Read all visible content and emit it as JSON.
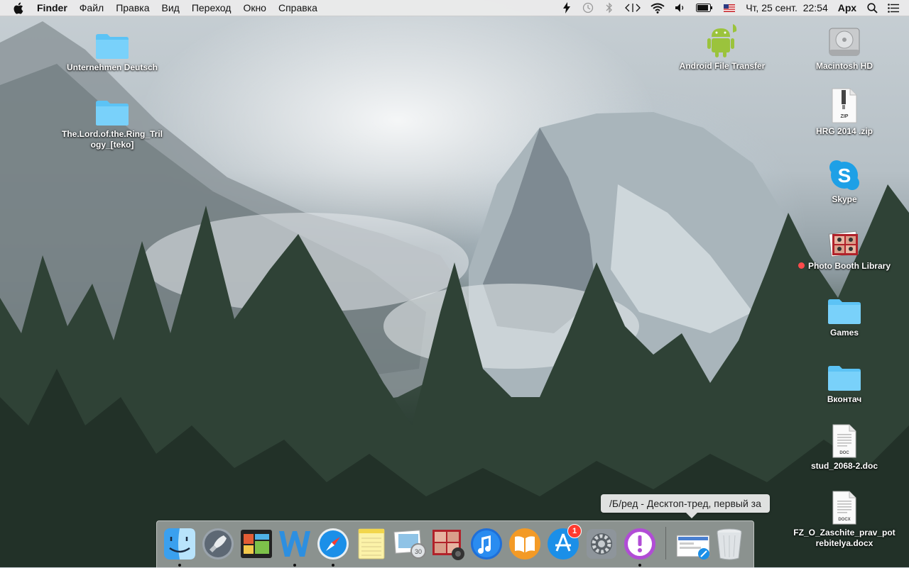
{
  "menubar": {
    "app_name": "Finder",
    "menus": [
      "Файл",
      "Правка",
      "Вид",
      "Переход",
      "Окно",
      "Справка"
    ],
    "clock": "Чт, 25 сент.  22:54",
    "user": "Арх"
  },
  "desktop_icons": [
    {
      "label": "Unternehmen Deutsch",
      "icon": "folder-icon"
    },
    {
      "label": "The.Lord.of.the.Ring_Trilogy_[teko]",
      "icon": "folder-icon"
    },
    {
      "label": "Android File Transfer",
      "icon": "android-icon"
    },
    {
      "label": "Macintosh HD",
      "icon": "hard-drive-icon"
    },
    {
      "label": "HRG 2014 .zip",
      "icon": "zip-file-icon",
      "badge": "ZIP"
    },
    {
      "label": "Skype",
      "icon": "skype-icon"
    },
    {
      "label": "Photo Booth Library",
      "icon": "photo-booth-library-icon",
      "tag_color": "#ff4b4b"
    },
    {
      "label": "Games",
      "icon": "folder-icon"
    },
    {
      "label": "Вконтач",
      "icon": "folder-icon"
    },
    {
      "label": "stud_2068-2.doc",
      "icon": "doc-file-icon",
      "badge": "DOC"
    },
    {
      "label": "FZ_O_Zaschite_prav_potrebitelya.docx",
      "icon": "docx-file-icon",
      "badge": "DOCX"
    }
  ],
  "dock": {
    "tooltip": "/Б/ред - Десктоп-тред, первый за",
    "app_store_badge": "1",
    "items": [
      "finder",
      "launchpad",
      "dashboard",
      "word",
      "safari",
      "notes",
      "preview",
      "photo-booth",
      "itunes",
      "ibooks",
      "app-store",
      "system-preferences",
      "alert-app",
      "downloads-stack",
      "trash"
    ]
  },
  "colors": {
    "folder": "#5cc3f5",
    "skype": "#1ea0e6",
    "android": "#9bc33c",
    "badge_red": "#ff3b30"
  }
}
